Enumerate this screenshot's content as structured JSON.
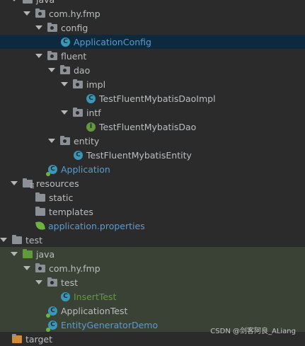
{
  "tree": {
    "items": [
      {
        "label": "java",
        "icon": "folder-icon"
      },
      {
        "label": "com.hy.fmp",
        "icon": "package-icon"
      },
      {
        "label": "config",
        "icon": "package-icon"
      },
      {
        "label": "ApplicationConfig",
        "icon": "class-icon"
      },
      {
        "label": "fluent",
        "icon": "package-icon"
      },
      {
        "label": "dao",
        "icon": "package-icon"
      },
      {
        "label": "impl",
        "icon": "package-icon"
      },
      {
        "label": "TestFluentMybatisDaoImpl",
        "icon": "class-icon"
      },
      {
        "label": "intf",
        "icon": "package-icon"
      },
      {
        "label": "TestFluentMybatisDao",
        "icon": "interface-icon"
      },
      {
        "label": "entity",
        "icon": "package-icon"
      },
      {
        "label": "TestFluentMybatisEntity",
        "icon": "class-icon"
      },
      {
        "label": "Application",
        "icon": "spring-boot-class-icon"
      },
      {
        "label": "resources",
        "icon": "resources-folder-icon"
      },
      {
        "label": "static",
        "icon": "folder-icon"
      },
      {
        "label": "templates",
        "icon": "folder-icon"
      },
      {
        "label": "application.properties",
        "icon": "spring-leaf-icon"
      },
      {
        "label": "test",
        "icon": "folder-icon"
      },
      {
        "label": "java",
        "icon": "test-source-folder-icon"
      },
      {
        "label": "com.hy.fmp",
        "icon": "package-icon"
      },
      {
        "label": "test",
        "icon": "package-icon"
      },
      {
        "label": "InsertTest",
        "icon": "test-class-icon"
      },
      {
        "label": "ApplicationTest",
        "icon": "spring-boot-class-icon"
      },
      {
        "label": "EntityGeneratorDemo",
        "icon": "spring-boot-class-icon"
      },
      {
        "label": "target",
        "icon": "excluded-folder-icon"
      }
    ]
  },
  "watermark": "CSDN @剑客阿良_ALiang",
  "colors": {
    "background": "#2b2b2b",
    "selection": "#0d293e",
    "test_background": "#3a4236",
    "text": "#bbbdbf",
    "link_blue": "#5a9bd4",
    "test_green": "#62993f"
  }
}
